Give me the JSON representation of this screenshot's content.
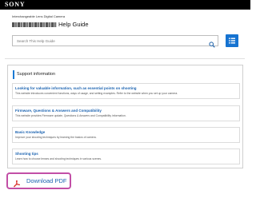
{
  "header": {
    "brand": "SONY",
    "subtitle": "Interchangeable Lens Digital Camera",
    "title_suffix": "Help Guide"
  },
  "search": {
    "placeholder": "Search This Help Guide",
    "button_icon": "search-icon"
  },
  "toc_button": {
    "icon": "list-icon"
  },
  "support": {
    "heading": "Support information",
    "items": [
      {
        "title": "Looking for valuable information, such as essential points on shooting",
        "description": "This website introduces convenient functions, ways of usage, and setting examples. Refer to the website when you set up your camera."
      },
      {
        "title": "Firmware, Questions & Answers and Compatibility",
        "description": "This website provides Firmware update, Questions & Answers and Compatibility information."
      },
      {
        "title": "Basic Knowledge",
        "description": "Improve your shooting techniques by learning the basics of camera."
      },
      {
        "title": "Shooting tips",
        "description": "Learn how to choose lenses and shooting techniques in various scenes."
      }
    ]
  },
  "download": {
    "label": "Download PDF",
    "icon": "pdf-icon"
  },
  "colors": {
    "accent": "#1673d1",
    "link": "#1a62b0",
    "highlight": "#c24fa6",
    "pdf_red": "#d9302b"
  }
}
